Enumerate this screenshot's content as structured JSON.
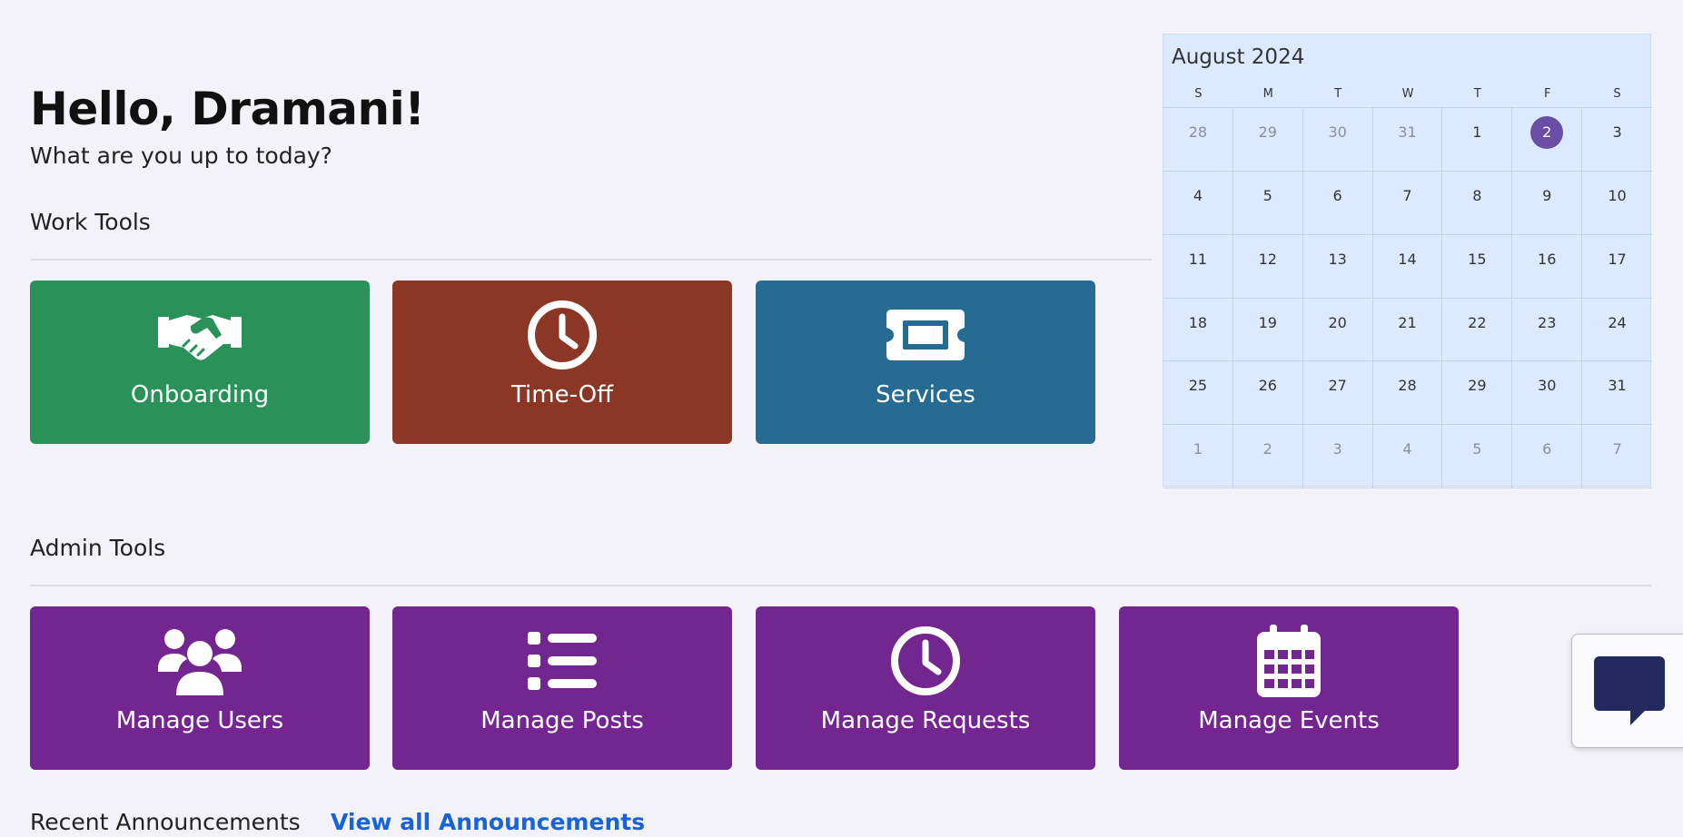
{
  "header": {
    "greeting": "Hello, Dramani!",
    "subtitle": "What are you up to today?"
  },
  "work_tools": {
    "title": "Work Tools",
    "tiles": [
      {
        "label": "Onboarding",
        "icon": "handshake-icon",
        "color": "#2a9158"
      },
      {
        "label": "Time-Off",
        "icon": "clock-icon",
        "color": "#8c3726"
      },
      {
        "label": "Services",
        "icon": "ticket-icon",
        "color": "#266b91"
      }
    ]
  },
  "admin_tools": {
    "title": "Admin Tools",
    "color": "#73268f",
    "tiles": [
      {
        "label": "Manage Users",
        "icon": "users-icon"
      },
      {
        "label": "Manage Posts",
        "icon": "list-icon"
      },
      {
        "label": "Manage Requests",
        "icon": "clock-icon"
      },
      {
        "label": "Manage Events",
        "icon": "calendar-icon"
      }
    ]
  },
  "calendar": {
    "title": "August 2024",
    "weekdays": [
      "S",
      "M",
      "T",
      "W",
      "T",
      "F",
      "S"
    ],
    "today": "2",
    "today_color": "#6a4ea6",
    "days": [
      {
        "d": "28",
        "m": true
      },
      {
        "d": "29",
        "m": true
      },
      {
        "d": "30",
        "m": true
      },
      {
        "d": "31",
        "m": true
      },
      {
        "d": "1"
      },
      {
        "d": "2",
        "t": true
      },
      {
        "d": "3"
      },
      {
        "d": "4"
      },
      {
        "d": "5"
      },
      {
        "d": "6"
      },
      {
        "d": "7"
      },
      {
        "d": "8"
      },
      {
        "d": "9"
      },
      {
        "d": "10"
      },
      {
        "d": "11"
      },
      {
        "d": "12"
      },
      {
        "d": "13"
      },
      {
        "d": "14"
      },
      {
        "d": "15"
      },
      {
        "d": "16"
      },
      {
        "d": "17"
      },
      {
        "d": "18"
      },
      {
        "d": "19"
      },
      {
        "d": "20"
      },
      {
        "d": "21"
      },
      {
        "d": "22"
      },
      {
        "d": "23"
      },
      {
        "d": "24"
      },
      {
        "d": "25"
      },
      {
        "d": "26"
      },
      {
        "d": "27"
      },
      {
        "d": "28"
      },
      {
        "d": "29"
      },
      {
        "d": "30"
      },
      {
        "d": "31"
      },
      {
        "d": "1",
        "m": true
      },
      {
        "d": "2",
        "m": true
      },
      {
        "d": "3",
        "m": true
      },
      {
        "d": "4",
        "m": true
      },
      {
        "d": "5",
        "m": true
      },
      {
        "d": "6",
        "m": true
      },
      {
        "d": "7",
        "m": true
      }
    ]
  },
  "announcements": {
    "title": "Recent Announcements",
    "link_label": "View all Announcements"
  },
  "chat": {
    "icon": "chat-bubble-icon",
    "color": "#242a5e"
  }
}
